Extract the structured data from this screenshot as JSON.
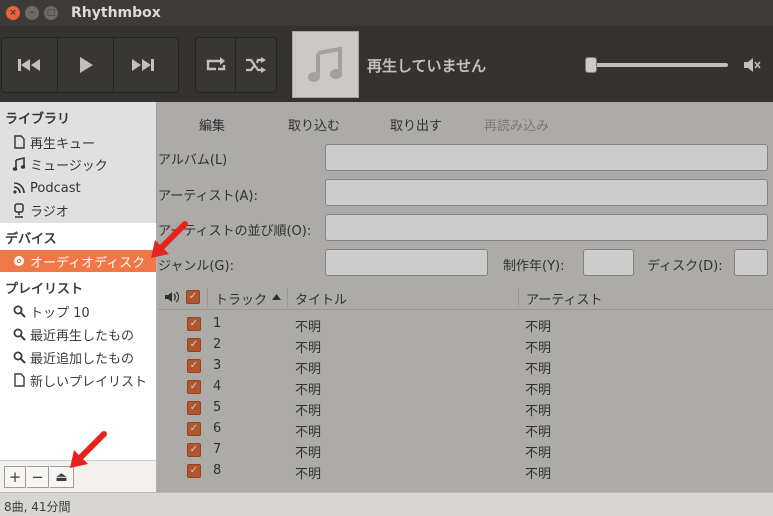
{
  "window": {
    "title": "Rhythmbox"
  },
  "player": {
    "now_playing": "再生していません",
    "volume": 0.0
  },
  "sidebar": {
    "library_header": "ライブラリ",
    "library_items": [
      {
        "label": "再生キュー",
        "icon": "page-icon"
      },
      {
        "label": "ミュージック",
        "icon": "music-note-icon"
      },
      {
        "label": "Podcast",
        "icon": "rss-icon"
      },
      {
        "label": "ラジオ",
        "icon": "radio-icon"
      }
    ],
    "devices_header": "デバイス",
    "device_items": [
      {
        "label": "オーディオディスク",
        "icon": "cd-icon",
        "selected": true
      }
    ],
    "playlists_header": "プレイリスト",
    "playlist_items": [
      {
        "label": "トップ 10",
        "icon": "search-icon"
      },
      {
        "label": "最近再生したもの",
        "icon": "search-icon"
      },
      {
        "label": "最近追加したもの",
        "icon": "search-icon"
      },
      {
        "label": "新しいプレイリスト",
        "icon": "page-icon"
      }
    ],
    "bottom_buttons": [
      "+",
      "−",
      "⏏"
    ]
  },
  "browse_toolbar": {
    "edit": "編集",
    "import": "取り込む",
    "eject": "取り出す",
    "reload": "再読み込み"
  },
  "form": {
    "album_label": "アルバム(L)",
    "artist_label": "アーティスト(A):",
    "artist_sort_label": "アーティストの並び順(O):",
    "genre_label": "ジャンル(G):",
    "year_label": "制作年(Y):",
    "disc_label": "ディスク(D):",
    "album_value": "",
    "artist_value": "",
    "artist_sort_value": "",
    "genre_value": "",
    "year_value": "",
    "disc_value": ""
  },
  "tracklist": {
    "columns": {
      "track": "トラック",
      "title": "タイトル",
      "artist": "アーティスト"
    },
    "rows": [
      {
        "track": "1",
        "title": "不明",
        "artist": "不明"
      },
      {
        "track": "2",
        "title": "不明",
        "artist": "不明"
      },
      {
        "track": "3",
        "title": "不明",
        "artist": "不明"
      },
      {
        "track": "4",
        "title": "不明",
        "artist": "不明"
      },
      {
        "track": "5",
        "title": "不明",
        "artist": "不明"
      },
      {
        "track": "6",
        "title": "不明",
        "artist": "不明"
      },
      {
        "track": "7",
        "title": "不明",
        "artist": "不明"
      },
      {
        "track": "8",
        "title": "不明",
        "artist": "不明"
      }
    ]
  },
  "status": {
    "text": "8曲, 41分間"
  },
  "colors": {
    "accent": "#f07746",
    "checkbox": "#dd6b3d",
    "annotation_arrow": "#e8231e"
  }
}
